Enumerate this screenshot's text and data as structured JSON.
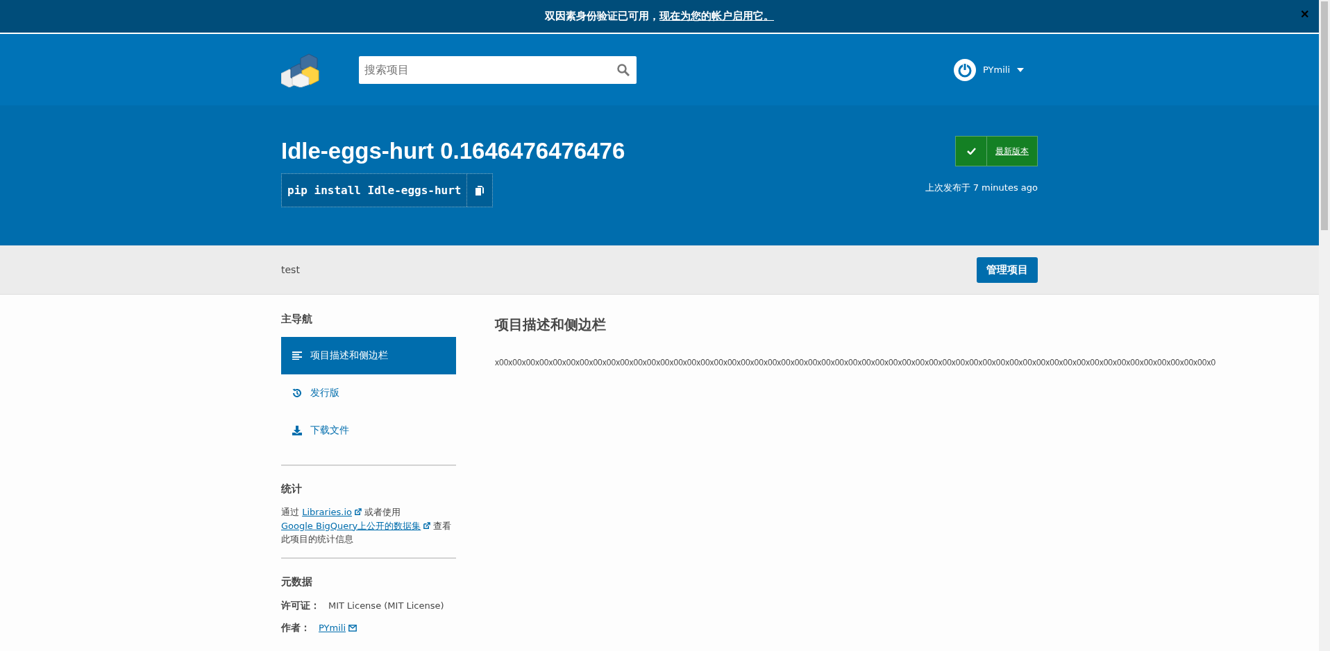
{
  "banner": {
    "text": "双因素身份验证已可用，",
    "link": "现在为您的帐户启用它。",
    "close": "✕"
  },
  "header": {
    "search": {
      "placeholder": "搜索项目"
    },
    "user": {
      "name": "PYmili"
    }
  },
  "hero": {
    "title": "Idle-eggs-hurt 0.1646476476476",
    "pip_command": "pip install Idle-eggs-hurt",
    "version_status": "最新版本",
    "released_label": "上次发布于 ",
    "released_time": "7 minutes ago"
  },
  "summary_bar": {
    "summary": "test",
    "manage_button": "管理项目"
  },
  "sidebar": {
    "nav_heading": "主导航",
    "nav_items": [
      {
        "label": "项目描述和侧边栏",
        "kind": "list",
        "selected": true
      },
      {
        "label": "发行版",
        "kind": "history",
        "selected": false
      },
      {
        "label": "下载文件",
        "kind": "download",
        "selected": false
      }
    ],
    "stats_heading": "统计",
    "stats_text": [
      {
        "text": "通过 ",
        "kind": "text"
      },
      {
        "text": "Libraries.io",
        "kind": "link"
      },
      {
        "text": " 或者使用 ",
        "kind": "text"
      },
      {
        "text": "Google BigQuery上公开的数据集",
        "kind": "link"
      },
      {
        "text": " 查看此项目的统计信息",
        "kind": "text"
      }
    ],
    "meta_heading": "元数据",
    "meta": [
      {
        "label": "许可证：",
        "value": "MIT License (MIT License)",
        "kind": "text"
      },
      {
        "label": "作者：",
        "value": "PYmili",
        "kind": "mail"
      }
    ]
  },
  "content": {
    "heading": "项目描述和侧边栏",
    "description": "x00x00x00x00x00x00x00x00x00x00x00x00x00x00x00x00x00x00x00x00x00x00x00x00x00x00x00x00x00x00x00x00x00x00x00x00x00x00x00x00x00x00x00x00x00x00x00x00x00x00x00x00x00x0"
  }
}
